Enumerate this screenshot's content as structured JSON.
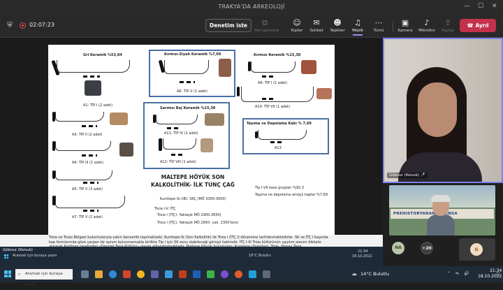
{
  "window": {
    "title": "TRAKYA'DA ARKEOLOJİ"
  },
  "toolbar": {
    "timer": "02:07:23",
    "denetim": "Denetim iste",
    "controls": {
      "yeni_pencere": "Yeni pencere",
      "kisiler": "Kişiler",
      "sohbet": "Sohbet",
      "tepkiler": "Tepkiler",
      "muzik": "Müzik",
      "tumu": "Tümü",
      "kamera": "Kamera",
      "mikrofon": "Mikrofon",
      "paylas": "Paylaş"
    },
    "leave": "Ayrıl"
  },
  "slide": {
    "gri": "Gri Keramik %53,84",
    "a1": "A1: TİP I (2 adet)",
    "a3": "A3: TİP II (2 adet)",
    "a4": "A4: TİP III (1 adet)",
    "a5": "A5: TİP V (3 adet)",
    "a7": "A7: TİP V (2 adet)",
    "kirmizi_siyah": "Kırmızı-Siyah Keramik %7,69",
    "a6": "A6: TİP V (1 adet)",
    "sarimsi": "Sarımsı Bej Keramik %15,38",
    "a11": "A11: TİP IV (1 adet)",
    "a12": "A12: TİP VIII (1 adet)",
    "kirmizi": "Kırmızı Keramik %15,38",
    "a9": "A9: TİP I (1 adet)",
    "a10": "A10: TİP VII (1 adet)",
    "tasima": "Taşıma ve Depolama Kabı % 7,69",
    "a13": "A13",
    "title1": "MALTEPE HÖYÜK SON",
    "title2": "KALKOLİTHİK- İLK TUNÇ ÇAĞ",
    "kumtepe": "Kumtepe Ib (IB): SKÇ (MÖ 3300-3000)",
    "troia15": "Troia I-V: İTÇ",
    "troia1": "Troia I (İTÇ): Yaklaşık MÖ 2900-2650)",
    "troia2": "Troia I (İTÇ): Yaklaşık MÖ 2650- yak. 2300'lere)",
    "tip_oran": "Tip I-VII kase grupları %92,3",
    "tasima_oran": "Taşıma ve depolama amaçlı kaplar %7,69",
    "paragraph": "Troia ve Troas Bölgesi buluntularıyla yakın benzerlik taşımaktadır. Kumtepe Ib (Son Kalkolitik) ile Troia I (İTÇ I) dönemine tarihlenmektedirler. SK ve İTÇ I başında kap formlarında göze çarpan bir aynım bulunmamakla birlikte Tip I için SK sonu olabileceği görüşü hakimdir. İTÇ I-III Troia kültürünün yayılım alanını dikkate alınarak Korfman tarafından «Denizel Troia Kültürü» olarak adlandırılmaktadır. Maltepe Höyük buluntuları: Kumtepe (Sperling), Troia, Hanay Tepe,"
  },
  "inner_taskbar": {
    "search": "Aramak için buraya yazın",
    "weather": "16°C Bulutlu",
    "time": "21:34",
    "date": "18.10.2022"
  },
  "stage_name": "Göknur (Konuk)",
  "side_video": {
    "name": "Göknur (Konuk)"
  },
  "thumb": {
    "banner": "PREHISTORYADAN BİZANSA"
  },
  "participants": {
    "na": "NA",
    "more": "+20",
    "g": "G"
  },
  "taskbar": {
    "search": "Aramak için buraya yazın",
    "weather": "14°C Bulutlu",
    "time": "21:34",
    "date": "18.10.2022"
  },
  "colors": {
    "accent": "#7b83eb",
    "leave": "#c4314b",
    "frame": "#4a6fa5"
  }
}
